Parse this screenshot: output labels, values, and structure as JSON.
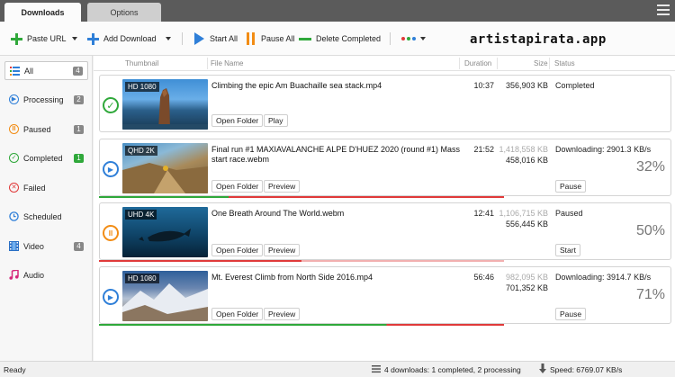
{
  "tabs": [
    {
      "label": "Downloads",
      "active": true
    },
    {
      "label": "Options",
      "active": false
    }
  ],
  "toolbar": {
    "paste_url": "Paste URL",
    "add_download": "Add Download",
    "start_all": "Start All",
    "pause_all": "Pause All",
    "delete_completed": "Delete Completed",
    "watermark": "artistapirata.app",
    "colors": {
      "green": "#2fa83a",
      "blue": "#2f7fd8",
      "orange": "#f28c14",
      "red": "#e03a3a"
    }
  },
  "sidebar": {
    "items": [
      {
        "label": "All",
        "count": "4",
        "icon": "list-icon",
        "selected": true
      },
      {
        "label": "Processing",
        "count": "2",
        "icon": "play-circle-icon"
      },
      {
        "label": "Paused",
        "count": "1",
        "icon": "pause-circle-icon"
      },
      {
        "label": "Completed",
        "count": "1",
        "icon": "check-circle-icon"
      },
      {
        "label": "Failed",
        "count": "",
        "icon": "x-circle-icon"
      },
      {
        "label": "Scheduled",
        "count": "",
        "icon": "clock-icon"
      },
      {
        "label": "Video",
        "count": "4",
        "icon": "film-icon"
      },
      {
        "label": "Audio",
        "count": "",
        "icon": "music-icon"
      }
    ]
  },
  "columns": {
    "thumbnail": "Thumbnail",
    "file_name": "File Name",
    "duration": "Duration",
    "size": "Size",
    "status": "Status"
  },
  "downloads": [
    {
      "badge": "HD 1080",
      "file_name": "Climbing the epic Am Buachaille sea stack.mp4",
      "duration": "10:37",
      "size_total": "",
      "size_done": "356,903 KB",
      "status": "Completed",
      "percent": "",
      "progress": 1.0,
      "state": "completed",
      "btn1": "Open Folder",
      "btn2": "Play",
      "action": ""
    },
    {
      "badge": "QHD 2K",
      "file_name": "Final run #1  MAXIAVALANCHE ALPE D'HUEZ 2020 (round #1) Mass start race.webm",
      "duration": "21:52",
      "size_total": "1,418,558 KB",
      "size_done": "458,016 KB",
      "status": "Downloading: 2901.3 KB/s",
      "percent": "32%",
      "progress": 0.32,
      "state": "downloading",
      "btn1": "Open Folder",
      "btn2": "Preview",
      "action": "Pause"
    },
    {
      "badge": "UHD 4K",
      "file_name": "One Breath Around The World.webm",
      "duration": "12:41",
      "size_total": "1,106,715 KB",
      "size_done": "556,445 KB",
      "status": "Paused",
      "percent": "50%",
      "progress": 0.5,
      "state": "paused",
      "btn1": "Open Folder",
      "btn2": "Preview",
      "action": "Start"
    },
    {
      "badge": "HD 1080",
      "file_name": "Mt. Everest Climb from North Side 2016.mp4",
      "duration": "56:46",
      "size_total": "982,095 KB",
      "size_done": "701,352 KB",
      "status": "Downloading: 3914.7 KB/s",
      "percent": "71%",
      "progress": 0.71,
      "state": "downloading",
      "btn1": "Open Folder",
      "btn2": "Preview",
      "action": "Pause"
    }
  ],
  "statusbar": {
    "left": "Ready",
    "summary": "4 downloads: 1 completed, 2 processing",
    "speed": "Speed: 6769.07 KB/s"
  }
}
